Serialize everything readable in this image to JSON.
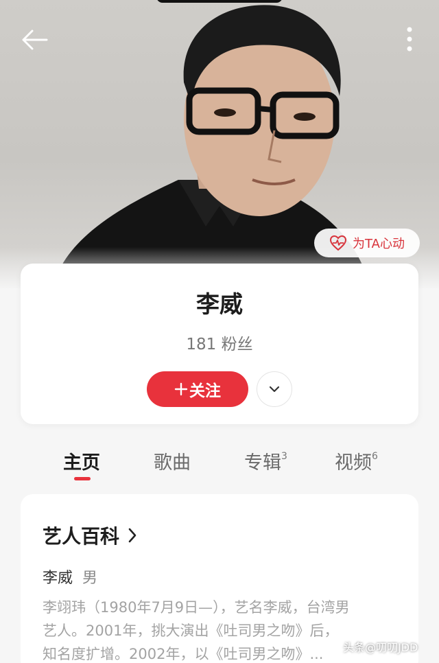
{
  "header": {
    "back_icon": "arrow-left-icon",
    "more_icon": "vertical-dots-icon",
    "heart_button": {
      "label": "为TA心动",
      "icon": "heart-pulse-icon"
    }
  },
  "profile": {
    "name": "李威",
    "fans": "181 粉丝",
    "follow_label": "关注",
    "follow_icon": "plus-icon",
    "expand_icon": "chevron-down-icon"
  },
  "tabs": [
    {
      "label": "主页",
      "badge": ""
    },
    {
      "label": "歌曲",
      "badge": ""
    },
    {
      "label": "专辑",
      "badge": "3"
    },
    {
      "label": "视频",
      "badge": "6"
    }
  ],
  "artist_info": {
    "section_title": "艺人百科",
    "name": "李威",
    "gender": "男",
    "bio_lines": [
      "李翊玮（1980年7月9日—），艺名李威，台湾男",
      "艺人。2001年，挑大演出《吐司男之吻》后，",
      "知名度扩增。2002年，以《吐司男之吻》..."
    ]
  },
  "watermark": "头条@叨叨JDD",
  "colors": {
    "accent": "#e8323c",
    "background": "#f6f6f6",
    "card": "#ffffff"
  }
}
